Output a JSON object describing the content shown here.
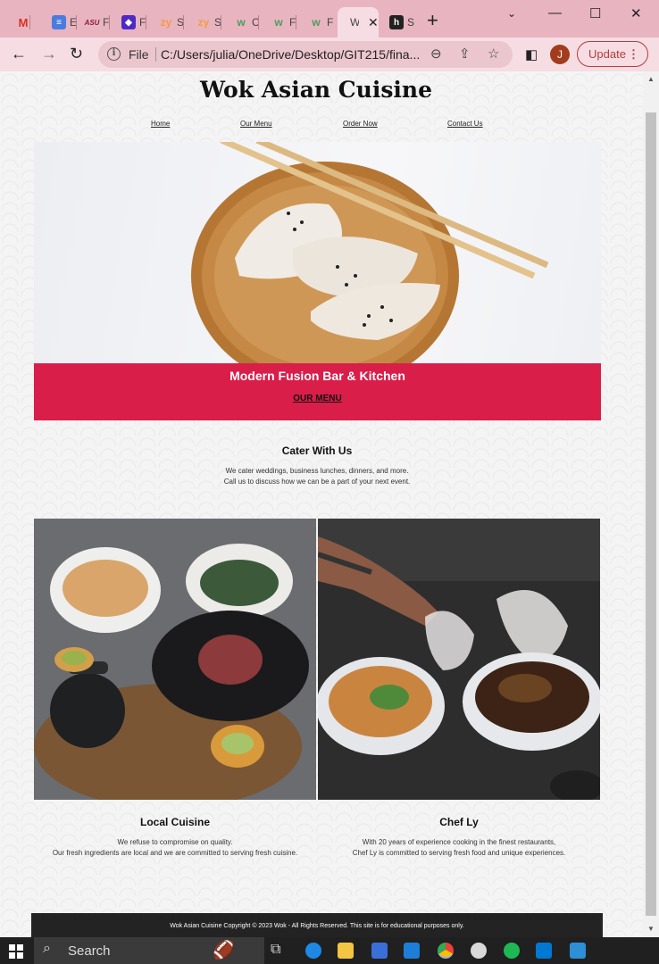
{
  "browser": {
    "tabs": [
      {
        "id": "gmail",
        "icon": "gmail-icon",
        "title": "M",
        "color": "#ffffff"
      },
      {
        "id": "docs",
        "icon": "docs-icon",
        "title": "E",
        "color": "#4a7ce0"
      },
      {
        "id": "asu",
        "icon": "asu-icon",
        "title": "F",
        "color": "#8c1d40"
      },
      {
        "id": "zybooks1",
        "icon": "zybooks-icon",
        "title": "F",
        "color": "#4d2ac5"
      },
      {
        "id": "zy2",
        "icon": "zy-icon",
        "title": "S",
        "color": "#f59b42"
      },
      {
        "id": "zy3",
        "icon": "zy-icon",
        "title": "S",
        "color": "#f59b42"
      },
      {
        "id": "w3",
        "icon": "w3schools-icon",
        "title": "C",
        "color": "#4a9e5c"
      },
      {
        "id": "w3b",
        "icon": "w3schools-icon",
        "title": "F",
        "color": "#4a9e5c"
      },
      {
        "id": "w3c",
        "icon": "w3schools-icon",
        "title": "F",
        "color": "#4a9e5c"
      },
      {
        "id": "wok",
        "icon": "wok-tab-icon",
        "title": "W",
        "active": true
      },
      {
        "id": "hu",
        "icon": "hu-icon",
        "title": "S",
        "color": "#222222"
      }
    ],
    "url_scheme": "File",
    "url": "C:/Users/julia/OneDrive/Desktop/GIT215/fina...",
    "avatar_letter": "J",
    "update_label": "Update"
  },
  "site": {
    "title": "Wok Asian Cuisine",
    "nav": [
      "Home",
      "Our Menu",
      "Order Now",
      "Contact Us"
    ],
    "banner_tagline": "Modern Fusion Bar & Kitchen",
    "banner_cta": "OUR MENU",
    "cater": {
      "heading": "Cater With Us",
      "line1": "We cater weddings, business lunches, dinners, and more.",
      "line2": "Call us to discuss how we can be a part of your next event."
    },
    "local": {
      "heading": "Local Cuisine",
      "line1": "We refuse to compromise on quality.",
      "line2": "Our fresh ingredients are local and we are committed to serving fresh cuisine."
    },
    "chef": {
      "heading": "Chef Ly",
      "line1": "With 20 years of experience cooking in the finest restaurants,",
      "line2": "Chef Ly is committed to serving fresh food and unique experiences."
    },
    "footer": "Wok Asian Cuisine Copyright © 2023 Wok - All Rights Reserved. This site is for educational purposes only.",
    "accent_color": "#d91e49"
  },
  "taskbar": {
    "search_label": "Search"
  }
}
